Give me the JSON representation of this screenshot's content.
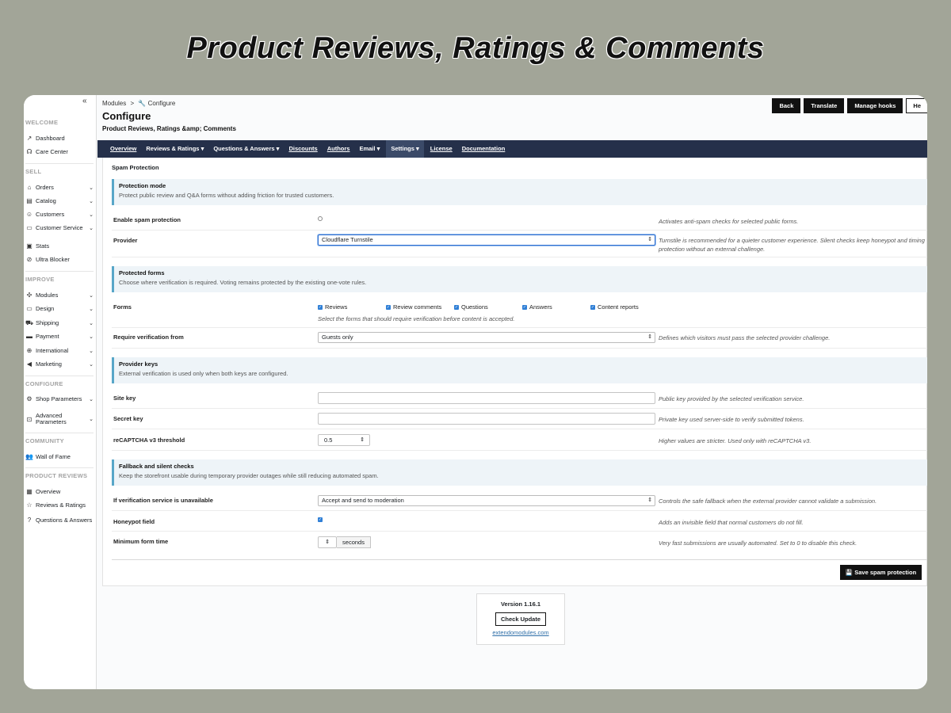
{
  "banner": "Product Reviews, Ratings & Comments",
  "sidebar": {
    "collapse_icon": "«",
    "sections": {
      "welcome": "WELCOME",
      "sell": "SELL",
      "improve": "IMPROVE",
      "configure": "CONFIGURE",
      "community": "COMMUNITY",
      "product_reviews": "PRODUCT REVIEWS"
    },
    "items": {
      "dashboard": "Dashboard",
      "care_center": "Care Center",
      "orders": "Orders",
      "catalog": "Catalog",
      "customers": "Customers",
      "customer_service": "Customer Service",
      "stats": "Stats",
      "ultra_blocker": "Ultra Blocker",
      "modules": "Modules",
      "design": "Design",
      "shipping": "Shipping",
      "payment": "Payment",
      "international": "International",
      "marketing": "Marketing",
      "shop_parameters": "Shop Parameters",
      "advanced_parameters": "Advanced Parameters",
      "wall_of_fame": "Wall of Fame",
      "overview": "Overview",
      "reviews_ratings": "Reviews & Ratings",
      "questions_answers": "Questions & Answers"
    }
  },
  "header": {
    "breadcrumb_modules": "Modules",
    "breadcrumb_sep": ">",
    "breadcrumb_configure": "Configure",
    "title": "Configure",
    "subtitle": "Product Reviews, Ratings &amp; Comments",
    "buttons": {
      "back": "Back",
      "translate": "Translate",
      "manage_hooks": "Manage hooks",
      "help": "He"
    }
  },
  "nav": {
    "overview": "Overview",
    "reviews_ratings": "Reviews & Ratings",
    "questions_answers": "Questions & Answers",
    "discounts": "Discounts",
    "authors": "Authors",
    "email": "Email",
    "settings": "Settings",
    "license": "License",
    "documentation": "Documentation",
    "caret": "▾"
  },
  "panel": {
    "heading": "Spam Protection",
    "protection_mode": {
      "title": "Protection mode",
      "desc": "Protect public review and Q&A forms without adding friction for trusted customers."
    },
    "enable": {
      "label": "Enable spam protection",
      "help": "Activates anti-spam checks for selected public forms."
    },
    "provider": {
      "label": "Provider",
      "value": "Cloudflare Turnstile",
      "help": "Turnstile is recommended for a quieter customer experience. Silent checks keep honeypot and timing protection without an external challenge."
    },
    "protected_forms": {
      "title": "Protected forms",
      "desc": "Choose where verification is required. Voting remains protected by the existing one-vote rules."
    },
    "forms": {
      "label": "Forms",
      "options": [
        "Reviews",
        "Review comments",
        "Questions",
        "Answers",
        "Content reports"
      ],
      "note": "Select the forms that should require verification before content is accepted."
    },
    "require_from": {
      "label": "Require verification from",
      "value": "Guests only",
      "help": "Defines which visitors must pass the selected provider challenge."
    },
    "provider_keys": {
      "title": "Provider keys",
      "desc": "External verification is used only when both keys are configured."
    },
    "site_key": {
      "label": "Site key",
      "help": "Public key provided by the selected verification service."
    },
    "secret_key": {
      "label": "Secret key",
      "help": "Private key used server-side to verify submitted tokens."
    },
    "threshold": {
      "label": "reCAPTCHA v3 threshold",
      "value": "0.5",
      "help": "Higher values are stricter. Used only with reCAPTCHA v3."
    },
    "fallback": {
      "title": "Fallback and silent checks",
      "desc": "Keep the storefront usable during temporary provider outages while still reducing automated spam."
    },
    "unavailable": {
      "label": "If verification service is unavailable",
      "value": "Accept and send to moderation",
      "help": "Controls the safe fallback when the external provider cannot validate a submission."
    },
    "honeypot": {
      "label": "Honeypot field",
      "help": "Adds an invisible field that normal customers do not fill."
    },
    "min_time": {
      "label": "Minimum form time",
      "addon": "seconds",
      "help": "Very fast submissions are usually automated. Set to 0 to disable this check."
    },
    "save": "Save spam protection"
  },
  "footer": {
    "version": "Version 1.16.1",
    "check_update": "Check Update",
    "link": "extendomodules.com"
  }
}
